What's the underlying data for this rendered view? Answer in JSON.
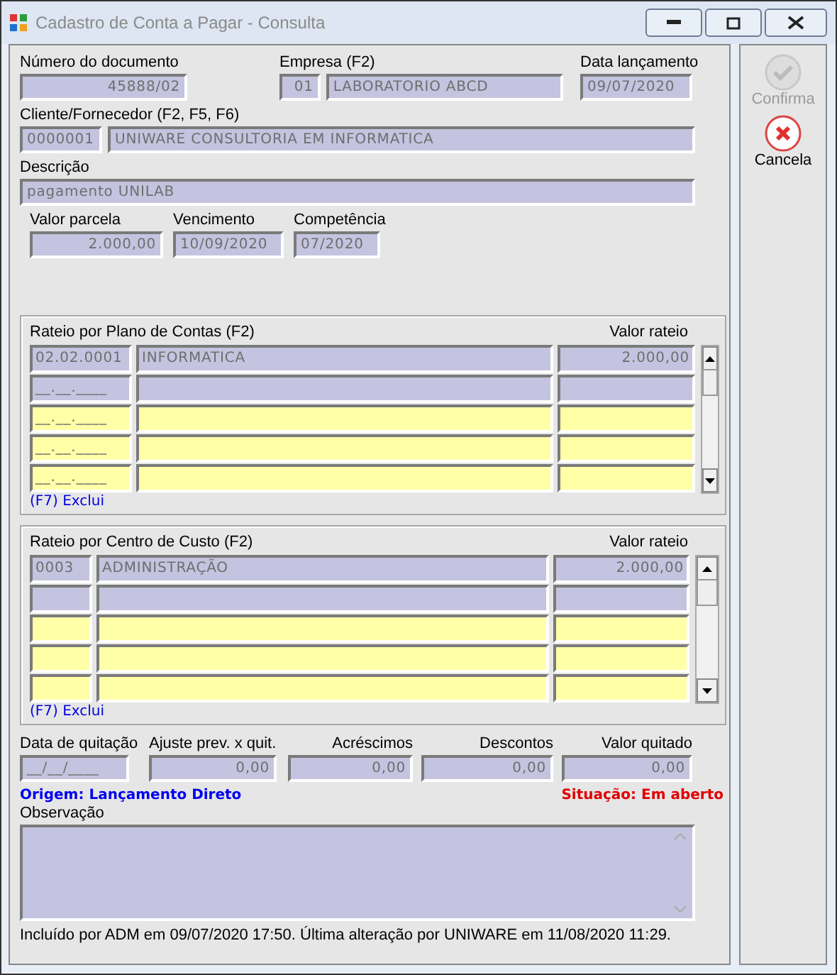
{
  "window": {
    "title": "Cadastro de Conta a Pagar - Consulta"
  },
  "header": {
    "documento": {
      "label": "Número do documento",
      "value": "45888/02"
    },
    "empresa": {
      "label": "Empresa (F2)",
      "code": "01",
      "name": "LABORATORIO ABCD"
    },
    "data_lancamento": {
      "label": "Data lançamento",
      "value": "09/07/2020"
    },
    "cliente": {
      "label": "Cliente/Fornecedor (F2, F5, F6)",
      "code": "0000001",
      "name": "UNIWARE CONSULTORIA EM INFORMATICA"
    },
    "descricao": {
      "label": "Descrição",
      "value": "pagamento UNILAB"
    },
    "valores": [
      {
        "label": "Valor parcela",
        "value": "2.000,00"
      },
      {
        "label": "Vencimento",
        "value": "10/09/2020"
      },
      {
        "label": "Competência",
        "value": "07/2020"
      }
    ]
  },
  "rateios": [
    {
      "title": "Rateio por Plano de Contas (F2)",
      "value_header": "Valor rateio",
      "footer": "(F7) Exclui",
      "rows": [
        {
          "kind": "readonly",
          "code": "02.02.0001",
          "name": "INFORMATICA",
          "value": "2.000,00"
        },
        {
          "kind": "readonly",
          "code": "__.__.____"
        },
        {
          "kind": "input",
          "code": "__.__.____"
        },
        {
          "kind": "input",
          "code": "__.__.____"
        },
        {
          "kind": "input",
          "code": "__.__.____"
        }
      ]
    },
    {
      "title": "Rateio por Centro de Custo (F2)",
      "value_header": "Valor rateio",
      "footer": "(F7) Exclui",
      "rows": [
        {
          "kind": "readonly",
          "code": "0003",
          "name": "ADMINISTRAÇÃO",
          "value": "2.000,00"
        },
        {
          "kind": "readonly"
        },
        {
          "kind": "input"
        },
        {
          "kind": "input"
        },
        {
          "kind": "input"
        }
      ]
    }
  ],
  "quitacao": [
    {
      "label": "Data de quitação",
      "value": "__/__/____"
    },
    {
      "label": "Ajuste prev. x quit.",
      "value": "0,00"
    },
    {
      "label": "Acréscimos",
      "value": "0,00"
    },
    {
      "label": "Descontos",
      "value": "0,00"
    },
    {
      "label": "Valor quitado",
      "value": "0,00"
    }
  ],
  "origem": "Origem: Lançamento Direto",
  "situacao": "Situação: Em aberto",
  "observacao": {
    "label": "Observação"
  },
  "footer": "Incluído por ADM em 09/07/2020 17:50. Última alteração por UNIWARE em 11/08/2020 11:29.",
  "buttons": [
    {
      "kind": "confirm",
      "label": "Confirma",
      "disabled": true
    },
    {
      "kind": "cancel",
      "label": "Cancela",
      "disabled": false
    }
  ]
}
